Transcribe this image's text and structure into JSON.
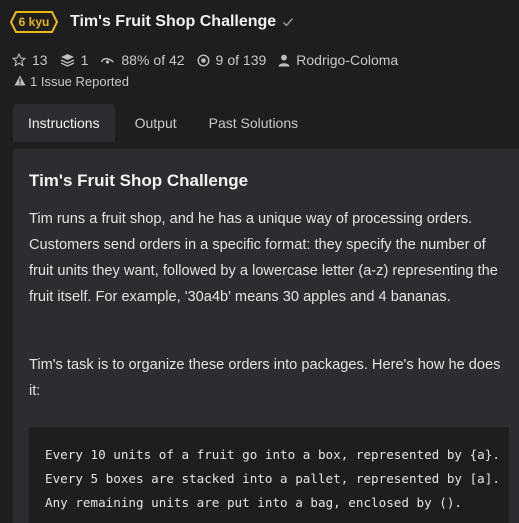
{
  "header": {
    "kyu_badge": "6 kyu",
    "title": "Tim's Fruit Shop Challenge",
    "badge_color": "#ecb613"
  },
  "stats": {
    "stars": "13",
    "collections": "1",
    "satisfaction": "88%",
    "satisfaction_suffix": "of 42",
    "completed": "9",
    "completed_suffix": "of 139",
    "author": "Rodrigo-Coloma"
  },
  "issues": {
    "label": "1 Issue Reported"
  },
  "tabs": [
    {
      "label": "Instructions",
      "active": true
    },
    {
      "label": "Output",
      "active": false
    },
    {
      "label": "Past Solutions",
      "active": false
    }
  ],
  "content": {
    "heading": "Tim's Fruit Shop Challenge",
    "paragraph1": "Tim runs a fruit shop, and he has a unique way of processing orders. Customers send orders in a specific format: they specify the number of fruit units they want, followed by a lowercase letter (a-z) representing the fruit itself. For example, '30a4b' means 30 apples and 4 bananas.",
    "paragraph2": "Tim's task is to organize these orders into packages. Here's how he does it:",
    "code_lines": [
      "Every 10 units of a fruit go into a box, represented by {a}.",
      "Every 5 boxes are stacked into a pallet, represented by [a].",
      "Any remaining units are put into a bag, enclosed by ()."
    ]
  }
}
